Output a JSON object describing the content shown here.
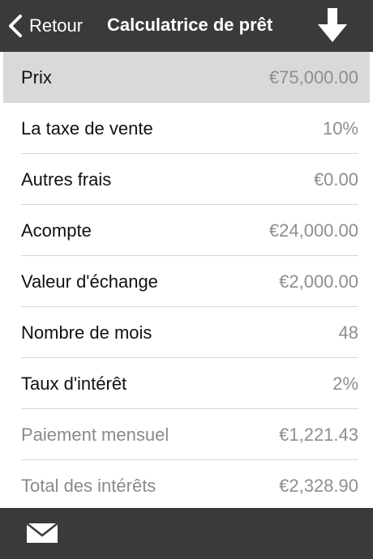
{
  "navbar": {
    "back_label": "Retour",
    "title": "Calculatrice de prêt",
    "back_icon": "chevron-left-icon",
    "download_icon": "arrow-down-icon"
  },
  "rows": [
    {
      "label": "Prix",
      "value": "€75,000.00"
    },
    {
      "label": "La taxe de vente",
      "value": "10%"
    },
    {
      "label": "Autres frais",
      "value": "€0.00"
    },
    {
      "label": "Acompte",
      "value": "€24,000.00"
    },
    {
      "label": "Valeur d'échange",
      "value": "€2,000.00"
    },
    {
      "label": "Nombre de mois",
      "value": "48"
    },
    {
      "label": "Taux d'intérêt",
      "value": "2%"
    },
    {
      "label": "Paiement mensuel",
      "value": "€1,221.43"
    },
    {
      "label": "Total des intérêts",
      "value": "€2,328.90"
    }
  ],
  "toolbar": {
    "mail_icon": "envelope-icon"
  },
  "colors": {
    "bar_background": "#3a3a3a",
    "selected_row": "#d9d9d9",
    "value_text": "#8e8e8e"
  }
}
